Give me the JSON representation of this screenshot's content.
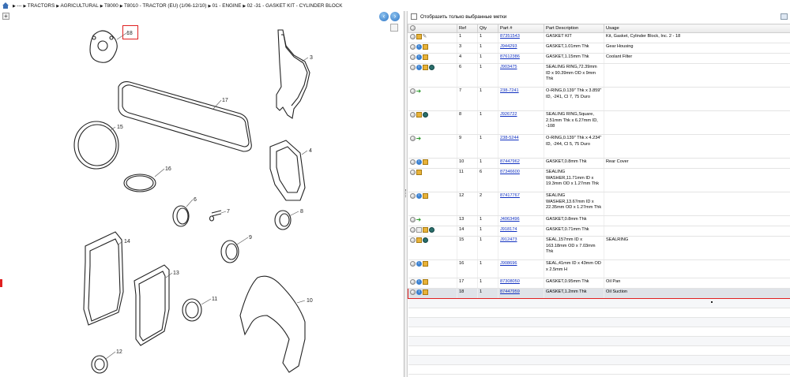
{
  "breadcrumb": {
    "items": [
      "---",
      "TRACTORS",
      "AGRICULTURAL",
      "T8000",
      "T8010 - TRACTOR (EU) (1/06-12/10)",
      "01 - ENGINE",
      "02 -31 - GASKET KIT - CYLINDER BLOCK"
    ]
  },
  "filter": {
    "label": "Отобразить только выбранные метки"
  },
  "diagram": {
    "labels": [
      "18",
      "3",
      "17",
      "15",
      "4",
      "16",
      "6",
      "7",
      "8",
      "9",
      "14",
      "13",
      "11",
      "10",
      "12"
    ]
  },
  "columns": {
    "ref": "Ref",
    "qty": "Qty",
    "part": "Part #",
    "desc": "Part Description",
    "usage": "Usage"
  },
  "rows": [
    {
      "icons": [
        "circle",
        "box",
        "wrench"
      ],
      "ref": "1",
      "qty": "1",
      "part": "87351543",
      "desc": "GASKET KIT",
      "usage": "Kit, Gasket, Cylinder Block, Inc. 2 - 18"
    },
    {
      "icons": [
        "circle",
        "info",
        "box"
      ],
      "ref": "3",
      "qty": "1",
      "part": "J944293",
      "desc": "GASKET,1.01mm Thk",
      "usage": "Gear Housing"
    },
    {
      "icons": [
        "circle",
        "info",
        "box"
      ],
      "ref": "4",
      "qty": "1",
      "part": "87612386",
      "desc": "GASKET,1.15mm Thk",
      "usage": "Coolant Filter"
    },
    {
      "icons": [
        "circle",
        "info",
        "box",
        "globe"
      ],
      "ref": "6",
      "qty": "1",
      "part": "J903475",
      "desc": "SEALING RING,72.39mm ID x 90.39mm OD x 9mm Thk",
      "usage": ""
    },
    {
      "icons": [
        "circle",
        "arrow"
      ],
      "ref": "7",
      "qty": "1",
      "part": "238-7241",
      "desc": "O-RING,0.139\" Thk x 3.859\" ID, -241, Cl 7, 75 Duro",
      "usage": ""
    },
    {
      "icons": [
        "circle",
        "box",
        "globe"
      ],
      "ref": "8",
      "qty": "1",
      "part": "J926722",
      "desc": "SEALING RING,Square, 2.51mm Thk x 6.27mm ID, -108",
      "usage": ""
    },
    {
      "icons": [
        "circle",
        "arrow"
      ],
      "ref": "9",
      "qty": "1",
      "part": "238-5244",
      "desc": "O-RING,0.139\" Thk x 4.234\" ID, -244, Cl 5, 75 Duro",
      "usage": ""
    },
    {
      "icons": [
        "circle",
        "info",
        "box"
      ],
      "ref": "10",
      "qty": "1",
      "part": "87447962",
      "desc": "GASKET,0.8mm Thk",
      "usage": "Rear Cover"
    },
    {
      "icons": [
        "circle",
        "box"
      ],
      "ref": "11",
      "qty": "6",
      "part": "87346600",
      "desc": "SEALING WASHER,11.71mm ID x 19.3mm OD x 1.27mm Thk",
      "usage": ""
    },
    {
      "icons": [
        "circle",
        "info",
        "box"
      ],
      "ref": "12",
      "qty": "2",
      "part": "87417767",
      "desc": "SEALING WASHER,13.67mm ID x 22.35mm OD x 1.27mm Thk",
      "usage": ""
    },
    {
      "icons": [
        "circle",
        "arrow"
      ],
      "ref": "13",
      "qty": "1",
      "part": "J4063496",
      "desc": "GASKET,0.8mm Thk",
      "usage": ""
    },
    {
      "icons": [
        "circle",
        "note",
        "box",
        "globe"
      ],
      "ref": "14",
      "qty": "1",
      "part": "J918174",
      "desc": "GASKET,0.71mm Thk",
      "usage": ""
    },
    {
      "icons": [
        "circle",
        "box",
        "globe"
      ],
      "ref": "15",
      "qty": "1",
      "part": "J912473",
      "desc": "SEAL,157mm ID x 163.18mm OD x 7.03mm Thk",
      "usage": "SEALRING"
    },
    {
      "icons": [
        "circle",
        "info",
        "box"
      ],
      "ref": "16",
      "qty": "1",
      "part": "J908696",
      "desc": "SEAL,41mm ID x 43mm OD x 2.5mm H",
      "usage": ""
    },
    {
      "icons": [
        "circle",
        "info",
        "box"
      ],
      "ref": "17",
      "qty": "1",
      "part": "87308050",
      "desc": "GASKET,0.95mm Thk",
      "usage": "Oil Pan"
    },
    {
      "icons": [
        "circle",
        "info",
        "box"
      ],
      "ref": "18",
      "qty": "1",
      "part": "87447959",
      "desc": "GASKET,1.2mm Thk",
      "usage": "Oil Suction"
    }
  ],
  "selected_ref": "18",
  "colors": {
    "selection_border": "#e02020",
    "link": "#1030c0"
  }
}
